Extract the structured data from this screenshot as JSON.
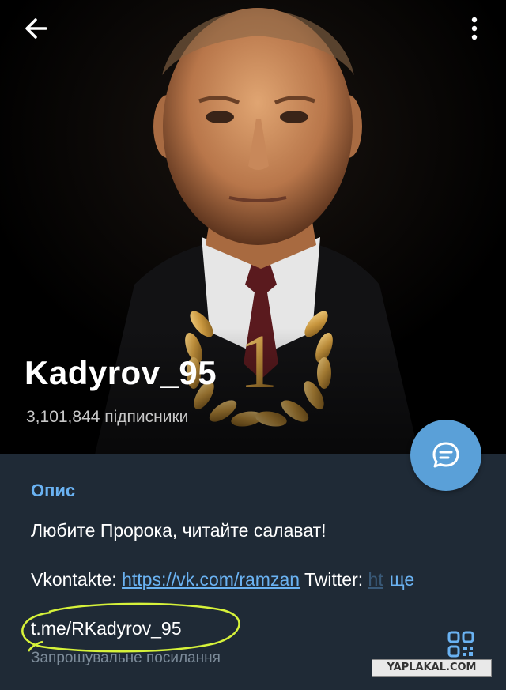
{
  "header": {
    "back_icon": "arrow-left-icon",
    "menu_icon": "more-vertical-icon",
    "photo": "channel-avatar-portrait-with-laurel-number-1",
    "laurel_number": "1"
  },
  "channel": {
    "name": "Kadyrov_95",
    "subscribers": "3,101,844 підписники"
  },
  "fab": {
    "icon": "message-icon",
    "color": "#5aa0d8"
  },
  "info": {
    "section_title": "Опис",
    "description": "Любите Пророка, читайте салават!",
    "vk_label": "Vkontakte: ",
    "vk_link": "https://vk.com/ramzan",
    "twitter_label": " Twitter: ",
    "twitter_link_partial": "ht",
    "more_label": "ще",
    "invite_link": "t.me/RKadyrov_95",
    "invite_caption": "Запрошувальне посилання",
    "qr_icon": "qr-code-icon"
  },
  "watermark": "YAPLAKAL.COM",
  "colors": {
    "accent": "#6ab2f2",
    "panel_bg": "#1f2a36",
    "fab": "#5aa0d8",
    "highlight_circle": "#d6f23a"
  }
}
